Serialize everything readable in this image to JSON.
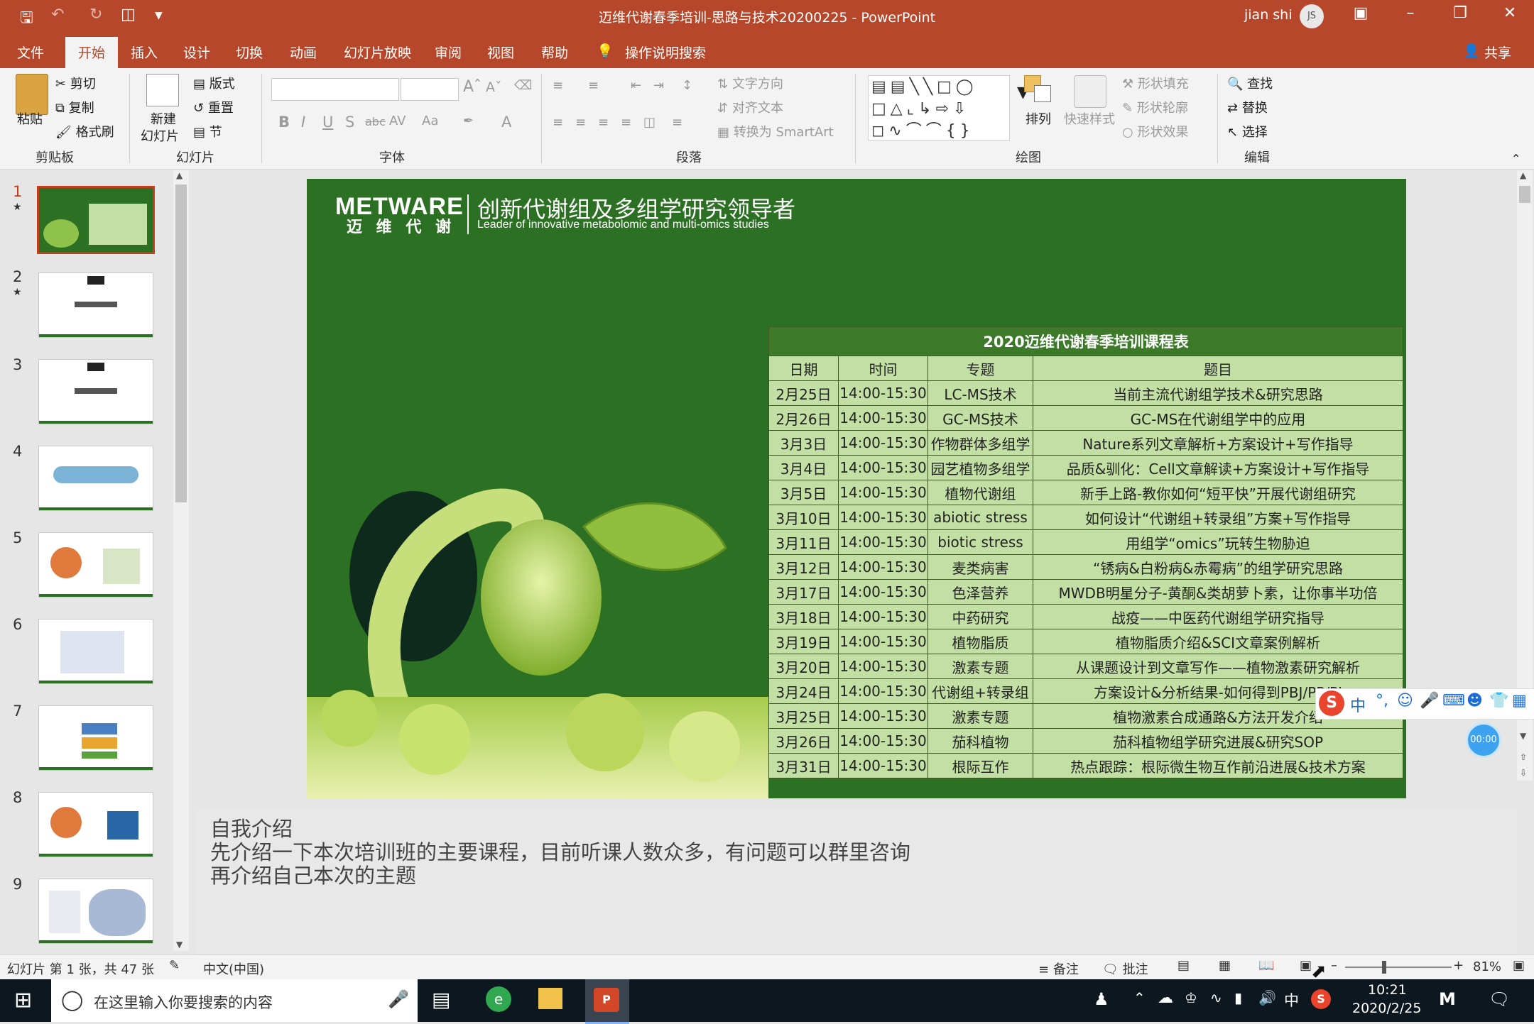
{
  "window": {
    "title": "迈维代谢春季培训-思路与技术20200225  -  PowerPoint",
    "user": "jian shi",
    "avatar_initials": "JS"
  },
  "tabs": [
    "文件",
    "开始",
    "插入",
    "设计",
    "切换",
    "动画",
    "幻灯片放映",
    "审阅",
    "视图",
    "帮助"
  ],
  "active_tab": "开始",
  "tell_me": "操作说明搜索",
  "share": "共享",
  "ribbon": {
    "clipboard": {
      "paste": "粘贴",
      "cut": "剪切",
      "copy": "复制",
      "format_painter": "格式刷",
      "group": "剪贴板"
    },
    "slides": {
      "new_slide_1": "新建",
      "new_slide_2": "幻灯片",
      "layout": "版式",
      "reset": "重置",
      "section": "节",
      "group": "幻灯片"
    },
    "font": {
      "group": "字体"
    },
    "paragraph": {
      "text_direction": "文字方向",
      "align_text": "对齐文本",
      "smartart": "转换为 SmartArt",
      "group": "段落"
    },
    "drawing": {
      "arrange": "排列",
      "quick_styles": "快速样式",
      "shape_fill": "形状填充",
      "shape_outline": "形状轮廓",
      "shape_effects": "形状效果",
      "group": "绘图"
    },
    "editing": {
      "find": "查找",
      "replace": "替换",
      "select": "选择",
      "group": "编辑"
    }
  },
  "thumbnails": [
    "1",
    "2",
    "3",
    "4",
    "5",
    "6",
    "7",
    "8",
    "9"
  ],
  "slide": {
    "logo_en": "METWARE",
    "logo_cn": "迈 维 代 谢",
    "tagline_cn": "创新代谢组及多组学研究领导者",
    "tagline_en": "Leader of innovative metabolomic and multi-omics studies",
    "table": {
      "caption": "2020迈维代谢春季培训课程表",
      "headers": [
        "日期",
        "时间",
        "专题",
        "题目"
      ],
      "rows": [
        [
          "2月25日",
          "14:00-15:30",
          "LC-MS技术",
          "当前主流代谢组学技术&研究思路"
        ],
        [
          "2月26日",
          "14:00-15:30",
          "GC-MS技术",
          "GC-MS在代谢组学中的应用"
        ],
        [
          "3月3日",
          "14:00-15:30",
          "作物群体多组学",
          "Nature系列文章解析+方案设计+写作指导"
        ],
        [
          "3月4日",
          "14:00-15:30",
          "园艺植物多组学",
          "品质&驯化：Cell文章解读+方案设计+写作指导"
        ],
        [
          "3月5日",
          "14:00-15:30",
          "植物代谢组",
          "新手上路-教你如何“短平快”开展代谢组研究"
        ],
        [
          "3月10日",
          "14:00-15:30",
          "abiotic stress",
          "如何设计“代谢组+转录组”方案+写作指导"
        ],
        [
          "3月11日",
          "14:00-15:30",
          "biotic stress",
          "用组学“omics”玩转生物胁迫"
        ],
        [
          "3月12日",
          "14:00-15:30",
          "麦类病害",
          "“锈病&白粉病&赤霉病”的组学研究思路"
        ],
        [
          "3月17日",
          "14:00-15:30",
          "色泽营养",
          "MWDB明星分子-黄酮&类胡萝卜素，让你事半功倍"
        ],
        [
          "3月18日",
          "14:00-15:30",
          "中药研究",
          "战疫——中医药代谢组学研究指导"
        ],
        [
          "3月19日",
          "14:00-15:30",
          "植物脂质",
          "植物脂质介绍&SCI文章案例解析"
        ],
        [
          "3月20日",
          "14:00-15:30",
          "激素专题",
          "从课题设计到文章写作——植物激素研究解析"
        ],
        [
          "3月24日",
          "14:00-15:30",
          "代谢组+转录组",
          "方案设计&分析结果-如何得到PBJ/PP/PJ"
        ],
        [
          "3月25日",
          "14:00-15:30",
          "激素专题",
          "植物激素合成通路&方法开发介绍"
        ],
        [
          "3月26日",
          "14:00-15:30",
          "茄科植物",
          "茄科植物组学研究进展&研究SOP"
        ],
        [
          "3月31日",
          "14:00-15:30",
          "根际互作",
          "热点跟踪：根际微生物互作前沿进展&技术方案"
        ]
      ]
    }
  },
  "notes": [
    "自我介绍",
    "先介绍一下本次培训班的主要课程，目前听课人数众多，有问题可以群里咨询",
    "再介绍自己本次的主题"
  ],
  "ime": {
    "mode": "中",
    "timer": "00:00"
  },
  "status": {
    "slide_info": "幻灯片 第 1 张，共 47 张",
    "language": "中文(中国)",
    "notes_btn": "备注",
    "comments_btn": "批注",
    "zoom": "81%"
  },
  "taskbar": {
    "search_placeholder": "在这里输入你要搜索的内容",
    "tray_ime": "中",
    "time": "10:21",
    "date": "2020/2/25"
  },
  "colors": {
    "accent": "#b7472a",
    "slide_green": "#2c7024",
    "table_cell": "#c3e0a4"
  }
}
